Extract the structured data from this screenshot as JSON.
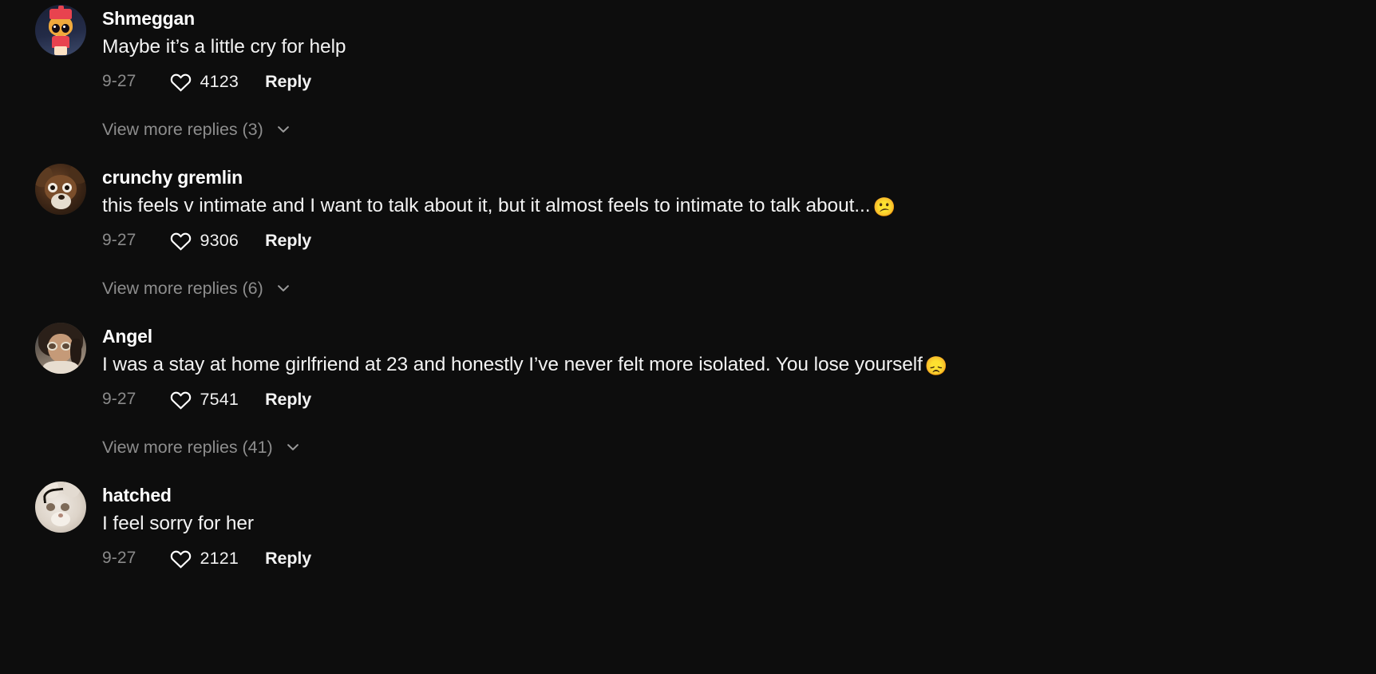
{
  "app": {
    "background_color": "#0d0d0d",
    "text_color": "#f2f2f2",
    "muted_color": "#8a8a8a"
  },
  "comments": [
    {
      "username": "Shmeggan",
      "text": "Maybe it’s a little cry for help",
      "emoji": "",
      "date": "9-27",
      "likes": "4123",
      "reply_label": "Reply",
      "avatar_name": "avatar-shmeggan",
      "view_more": "View more replies (3)"
    },
    {
      "username": "crunchy gremlin",
      "text": "this feels v intimate and I want to talk about it, but it almost feels to intimate to talk about...",
      "emoji": "😕",
      "date": "9-27",
      "likes": "9306",
      "reply_label": "Reply",
      "avatar_name": "avatar-crunchy-gremlin",
      "view_more": "View more replies (6)"
    },
    {
      "username": "Angel",
      "text": "I was a stay at home girlfriend at 23 and honestly I’ve never felt more isolated. You lose yourself",
      "emoji": "😞",
      "date": "9-27",
      "likes": "7541",
      "reply_label": "Reply",
      "avatar_name": "avatar-angel",
      "view_more": "View more replies (41)"
    },
    {
      "username": "hatched",
      "text": "I feel sorry for her",
      "emoji": "",
      "date": "9-27",
      "likes": "2121",
      "reply_label": "Reply",
      "avatar_name": "avatar-hatched",
      "view_more": ""
    }
  ],
  "icons": {
    "heart": "heart-icon",
    "chevron": "chevron-down-icon"
  }
}
